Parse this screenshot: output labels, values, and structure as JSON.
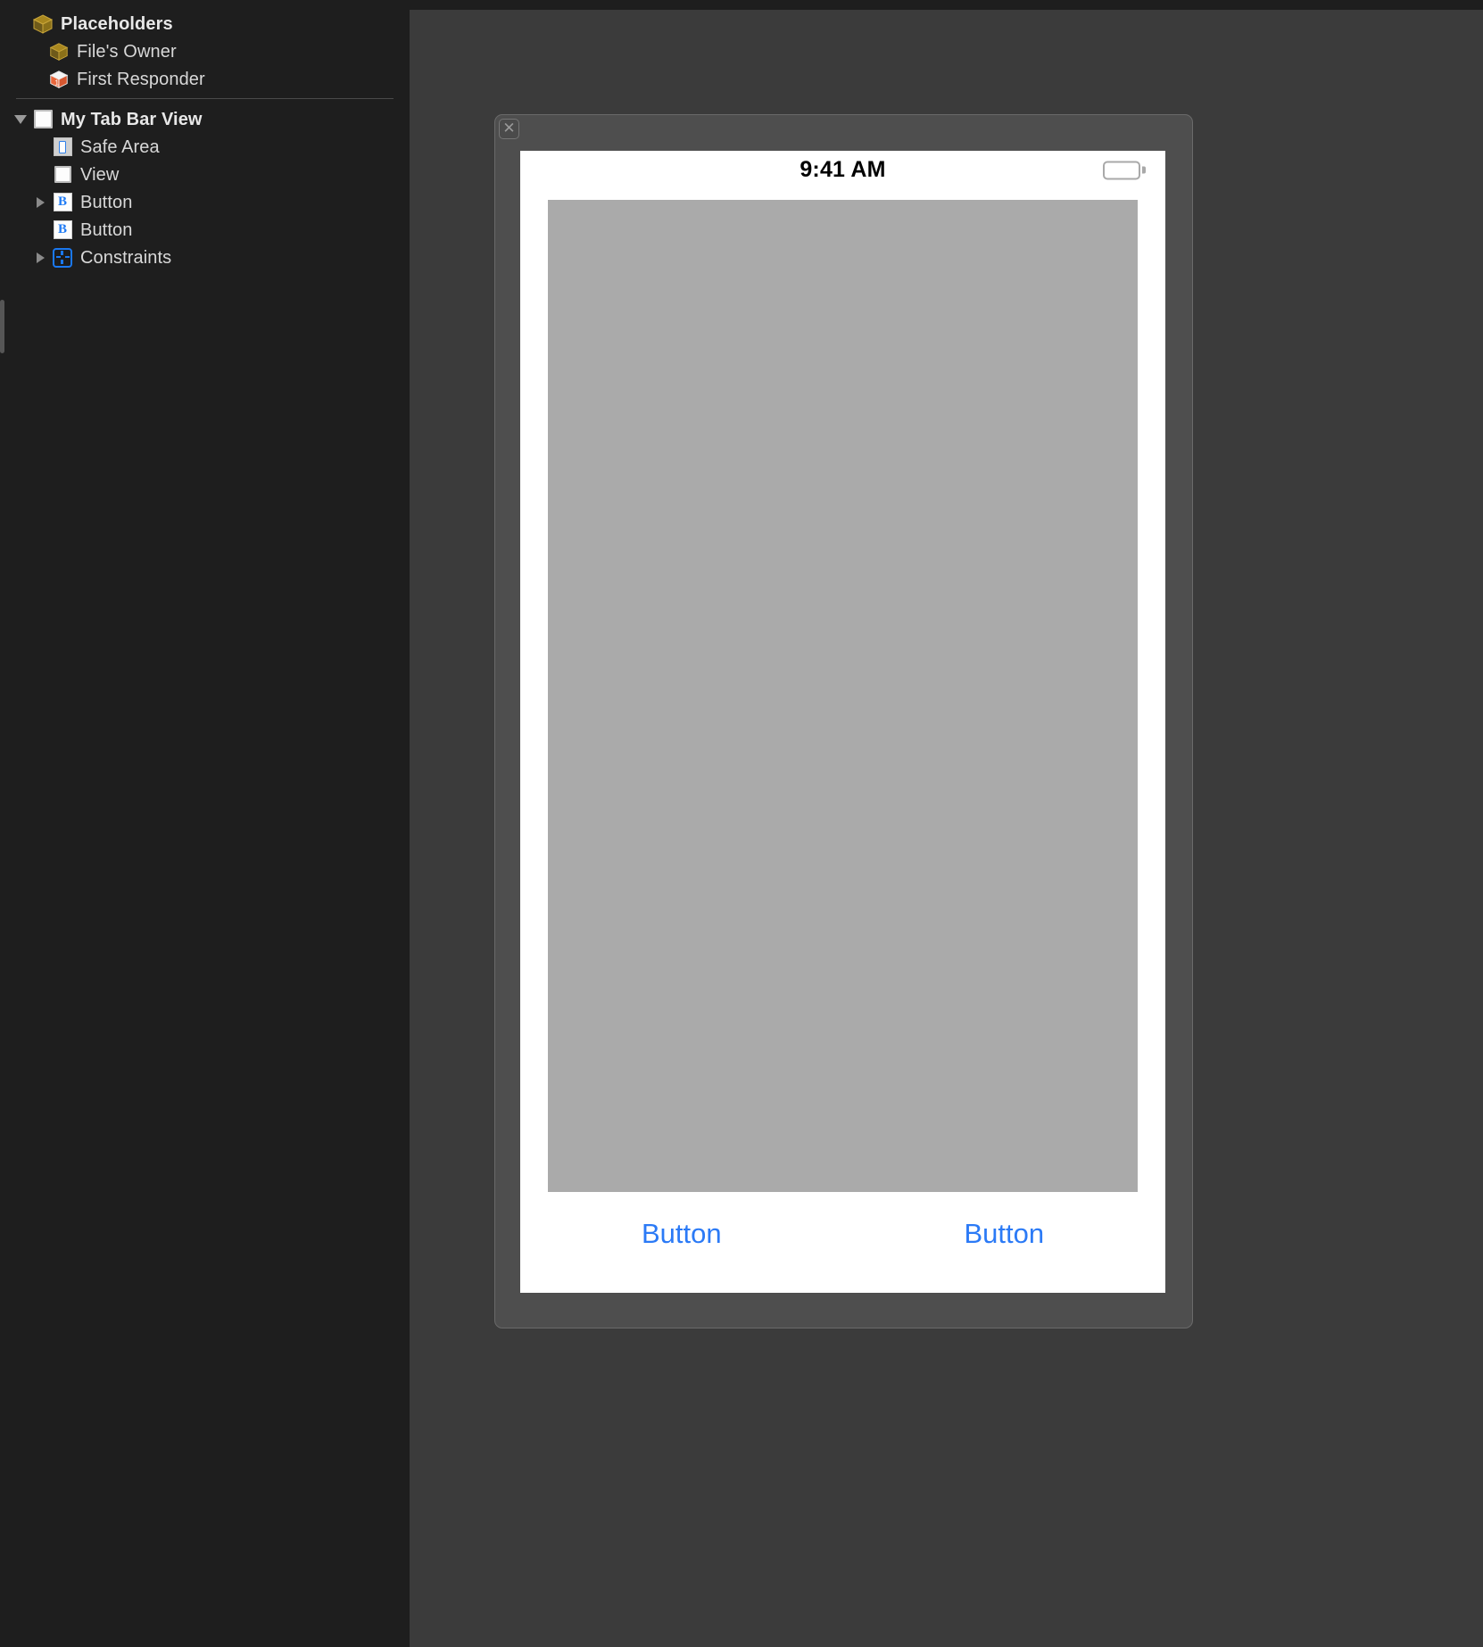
{
  "app": {
    "accent_blue": "#2b7af6",
    "sidebar_bg": "#1e1e1e",
    "canvas_bg": "#3b3b3b"
  },
  "outline": {
    "sections": [
      {
        "header": {
          "label": "Placeholders",
          "icon": "cube-icon"
        },
        "items": [
          {
            "label": "File's Owner",
            "icon": "cube-icon"
          },
          {
            "label": "First Responder",
            "icon": "first-responder-cube-icon"
          }
        ]
      }
    ],
    "scene": {
      "root": {
        "label": "My Tab Bar View",
        "icon": "view-square-icon",
        "expanded": true
      },
      "children": [
        {
          "label": "Safe Area",
          "icon": "safe-area-icon",
          "disclosure": false
        },
        {
          "label": "View",
          "icon": "view-square-icon",
          "disclosure": false
        },
        {
          "label": "Button",
          "icon": "button-icon",
          "disclosure": true
        },
        {
          "label": "Button",
          "icon": "button-icon",
          "disclosure": false
        },
        {
          "label": "Constraints",
          "icon": "constraints-icon",
          "disclosure": true
        }
      ]
    }
  },
  "canvas": {
    "device": {
      "close_label": "✕",
      "status_bar": {
        "time": "9:41 AM",
        "battery_icon": "battery-full-icon"
      },
      "tab_bar": {
        "buttons": [
          {
            "label": "Button"
          },
          {
            "label": "Button"
          }
        ]
      }
    }
  }
}
